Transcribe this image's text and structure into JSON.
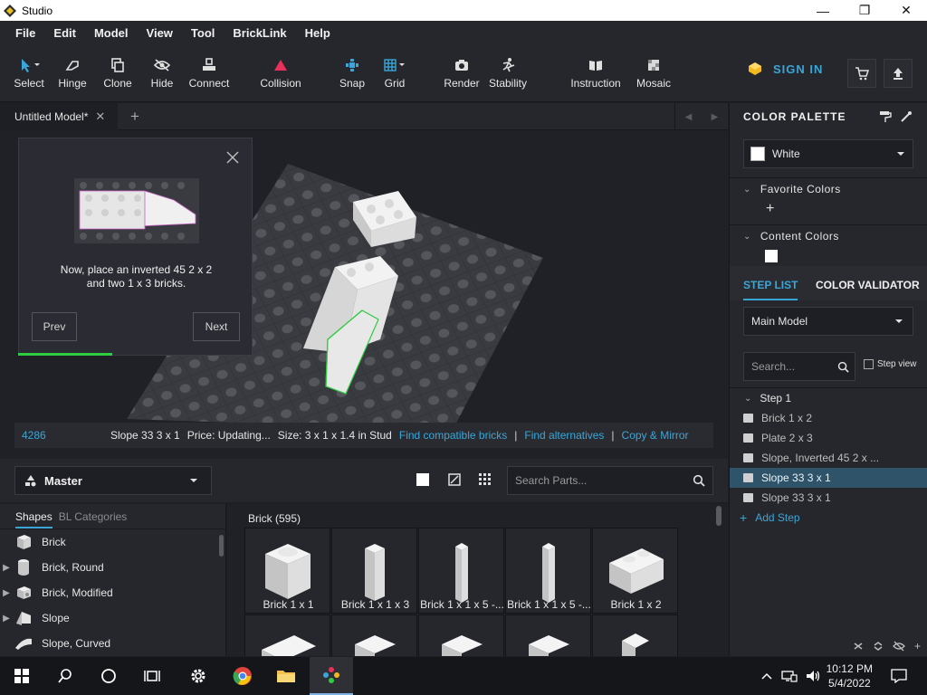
{
  "window": {
    "title": "Studio",
    "controls": {
      "minimize": "—",
      "maximize": "❐",
      "close": "✕"
    }
  },
  "menu": [
    "File",
    "Edit",
    "Model",
    "View",
    "Tool",
    "BrickLink",
    "Help"
  ],
  "toolbar": {
    "tools": [
      {
        "label": "Select",
        "icon": "cursor-icon"
      },
      {
        "label": "Hinge",
        "icon": "hinge-icon"
      },
      {
        "label": "Clone",
        "icon": "clone-icon"
      },
      {
        "label": "Hide",
        "icon": "hide-icon"
      },
      {
        "label": "Connect",
        "icon": "connect-icon"
      },
      {
        "label": "Collision",
        "icon": "collision-icon"
      },
      {
        "label": "Snap",
        "icon": "snap-icon"
      },
      {
        "label": "Grid",
        "icon": "grid-icon"
      },
      {
        "label": "Render",
        "icon": "camera-icon"
      },
      {
        "label": "Stability",
        "icon": "stability-icon"
      },
      {
        "label": "Instruction",
        "icon": "instruction-icon"
      },
      {
        "label": "Mosaic",
        "icon": "mosaic-icon"
      }
    ],
    "sign_in": "SIGN IN"
  },
  "tabs": {
    "active": "Untitled Model*",
    "close": "✕",
    "add": "+",
    "prev": "◀",
    "next": "▶"
  },
  "tutorial": {
    "text_line1": "Now, place an inverted 45 2 x 2",
    "text_line2": "and two 1 x 3 bricks.",
    "prev": "Prev",
    "next": "Next",
    "progress": 0.4
  },
  "status": {
    "id": "4286",
    "part": "Slope 33 3 x 1",
    "price": "Price: Updating...",
    "size": "Size: 3 x 1 x 1.4 in Stud",
    "links": [
      "Find compatible bricks",
      "Find alternatives",
      "Copy & Mirror"
    ],
    "sep": "|"
  },
  "parts": {
    "palette": "Master",
    "search_placeholder": "Search Parts...",
    "shape_tabs": [
      "Shapes",
      "BL Categories"
    ],
    "shapes": [
      {
        "label": "Brick",
        "expandable": false
      },
      {
        "label": "Brick, Round",
        "expandable": true
      },
      {
        "label": "Brick, Modified",
        "expandable": true
      },
      {
        "label": "Slope",
        "expandable": true
      },
      {
        "label": "Slope, Curved",
        "expandable": false
      }
    ],
    "category_title": "Brick (595)",
    "tiles": [
      "Brick 1 x 1",
      "Brick 1 x 1 x 3",
      "Brick 1 x 1 x 5 -...",
      "Brick 1 x 1 x 5 -...",
      "Brick 1 x 2"
    ]
  },
  "right_panel": {
    "title": "COLOR PALETTE",
    "color": "White",
    "favorite_colors": "Favorite Colors",
    "content_colors": "Content Colors",
    "add": "+",
    "tab_step_list": "STEP LIST",
    "tab_color_validator": "COLOR VALIDATOR",
    "model": "Main Model",
    "search_placeholder": "Search...",
    "step_view": "Step view",
    "step_header": "Step 1",
    "steps": [
      "Brick 1 x 2",
      "Plate 2 x 3",
      "Slope, Inverted 45 2 x ...",
      "Slope 33 3 x 1",
      "Slope 33 3 x 1"
    ],
    "selected_step_index": 3,
    "add_step": "Add Step"
  },
  "taskbar": {
    "time": "10:12 PM",
    "date": "5/4/2022"
  },
  "colors": {
    "accent": "#3aa6d8",
    "selection": "#2f5368",
    "progress": "#2ecc40",
    "collision": "#e8305a"
  }
}
